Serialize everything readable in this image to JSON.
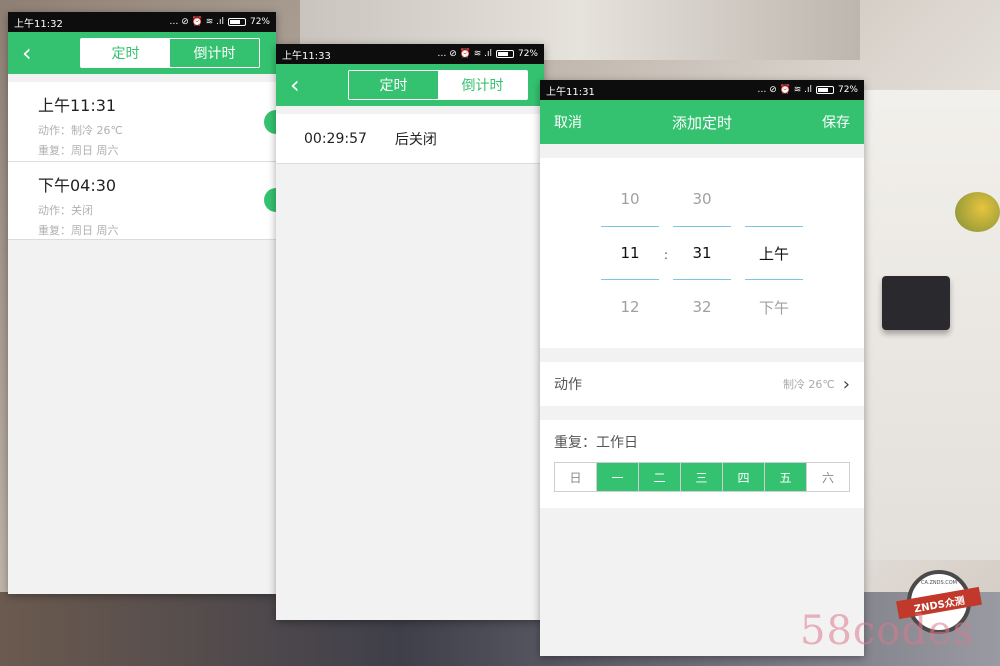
{
  "colors": {
    "accent": "#35c270",
    "picker_line": "#7cc4e8"
  },
  "statusbar": {
    "battery": "72%",
    "phone1_time": "上午11:32",
    "phone2_time": "上午11:33",
    "phone3_time": "上午11:31"
  },
  "tabs": {
    "timer": "定时",
    "countdown": "倒计时"
  },
  "phone1": {
    "items": [
      {
        "time": "上午11:31",
        "action": "动作：制冷 26℃",
        "repeat": "重复：周日 周六"
      },
      {
        "time": "下午04:30",
        "action": "动作：关闭",
        "repeat": "重复：周日 周六"
      }
    ]
  },
  "phone2": {
    "countdown": "00:29:57",
    "label": "后关闭"
  },
  "phone3": {
    "cancel": "取消",
    "title": "添加定时",
    "save": "保存",
    "picker": {
      "hour": [
        "10",
        "11",
        "12"
      ],
      "minute": [
        "30",
        "31",
        "32"
      ],
      "ampm": [
        "",
        "上午",
        "下午"
      ],
      "colon": ":"
    },
    "action_label": "动作",
    "action_value": "制冷 26℃",
    "repeat_label": "重复：工作日",
    "days": [
      {
        "label": "日",
        "on": false
      },
      {
        "label": "一",
        "on": true
      },
      {
        "label": "二",
        "on": true
      },
      {
        "label": "三",
        "on": true
      },
      {
        "label": "四",
        "on": true
      },
      {
        "label": "五",
        "on": true
      },
      {
        "label": "六",
        "on": false
      }
    ]
  },
  "watermark": {
    "logo_text": "ZNDS众测",
    "logo_url": "CA.ZNDS.COM",
    "site": "58codes"
  }
}
